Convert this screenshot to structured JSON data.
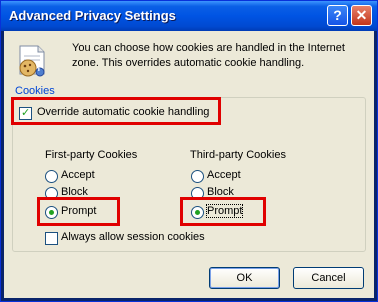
{
  "window": {
    "title": "Advanced Privacy Settings",
    "help_glyph": "?",
    "close_glyph": "✕"
  },
  "intro": {
    "icon": "cookie-settings-icon",
    "text": "You can choose how cookies are handled in the Internet zone.  This overrides automatic cookie handling."
  },
  "cookies_group": {
    "label": "Cookies",
    "override_label": "Override automatic cookie handling",
    "override_checked": true,
    "first_party": {
      "heading": "First-party Cookies",
      "options": [
        "Accept",
        "Block",
        "Prompt"
      ],
      "selected": "Prompt"
    },
    "third_party": {
      "heading": "Third-party Cookies",
      "options": [
        "Accept",
        "Block",
        "Prompt"
      ],
      "selected": "Prompt"
    },
    "session_label": "Always allow session cookies",
    "session_checked": false
  },
  "buttons": {
    "ok": "OK",
    "cancel": "Cancel"
  },
  "highlight_color": "#e00000"
}
